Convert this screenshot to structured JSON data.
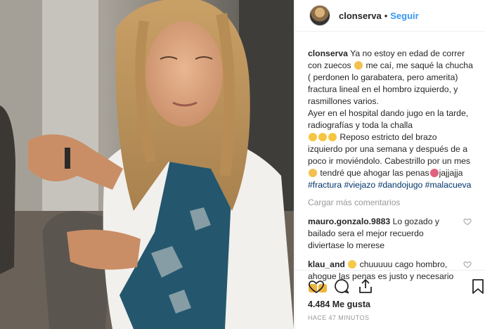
{
  "header": {
    "username": "clonserva",
    "separator": "•",
    "follow_label": "Seguir"
  },
  "caption": {
    "username": "clonserva",
    "text_part1": "Ya no estoy en edad de correr con zuecos",
    "text_part2": "me caí, me saqué la chucha ( perdonen lo garabatera, pero amerita) fractura lineal en el hombro izquierdo, y rasmillones varios.\nAyer en el hospital dando jugo en la tarde, radiografías y toda la challa",
    "text_part3": "Reposo estricto del brazo izquierdo por una semana y después de a poco ir moviéndolo. Cabestrillo por un mes",
    "text_part4": "tendré que ahogar las penas",
    "text_part5": "jajjajja",
    "hashtags": "#fractura #viejazo #dandojugo #malacueva"
  },
  "load_more_label": "Cargar más comentarios",
  "comments": [
    {
      "username": "mauro.gonzalo.9883",
      "text": "Lo gozado y bailado sera el mejor recuerdo diviertase lo merese"
    },
    {
      "username": "klau_and",
      "text": "chuuuuu cago hombro, ahogue las penas es justo y necesario"
    }
  ],
  "likes_text": "4.484 Me gusta",
  "time_text": "HACE 47 MINUTOS",
  "icons": {
    "like": "heart-icon",
    "comment": "comment-icon",
    "share": "share-icon",
    "save": "bookmark-icon",
    "comment_like": "heart-icon"
  },
  "colors": {
    "follow": "#3897f0",
    "hashtag": "#003569",
    "muted": "#999999",
    "text": "#262626"
  }
}
